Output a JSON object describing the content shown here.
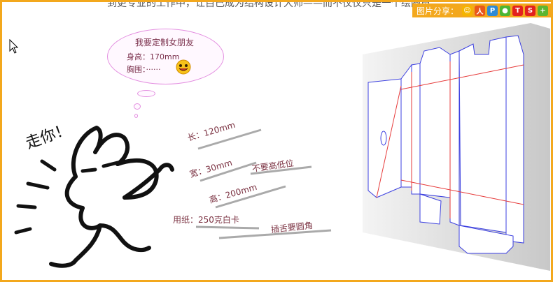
{
  "header": {
    "top_text": "到更专业的工作中，让自己成为结构设计大师——而不仅仅只是一个绘图员。"
  },
  "share": {
    "label": "图片分享：",
    "icons": [
      {
        "name": "qzone",
        "color": "#f5b400",
        "glyph": "☺"
      },
      {
        "name": "renren",
        "color": "#e9571b",
        "glyph": "人"
      },
      {
        "name": "tencent",
        "color": "#2d8ad6",
        "glyph": "P"
      },
      {
        "name": "wechat",
        "color": "#4cb632",
        "glyph": "●"
      },
      {
        "name": "tieba",
        "color": "#e3211e",
        "glyph": "T"
      },
      {
        "name": "weibo",
        "color": "#e3211e",
        "glyph": "S"
      },
      {
        "name": "more",
        "color": "#5cb530",
        "glyph": "+"
      }
    ]
  },
  "bubble": {
    "title": "我要定制女朋友",
    "height": "身高：170mm",
    "chest": "胸围：······"
  },
  "rabbit": {
    "shout": "走你！"
  },
  "notes": {
    "length": "长：120mm",
    "width": "宽：30mm",
    "no_low": "不要高低位",
    "height": "高：200mm",
    "paper": "用纸：250克白卡",
    "tongue": "插舌要圆角"
  },
  "colors": {
    "frame": "#f3a81d",
    "text": "#7a3040",
    "bubble_border": "#e38ee0",
    "dieline_blue": "#3b3fe0",
    "dieline_red": "#e63a3a"
  }
}
